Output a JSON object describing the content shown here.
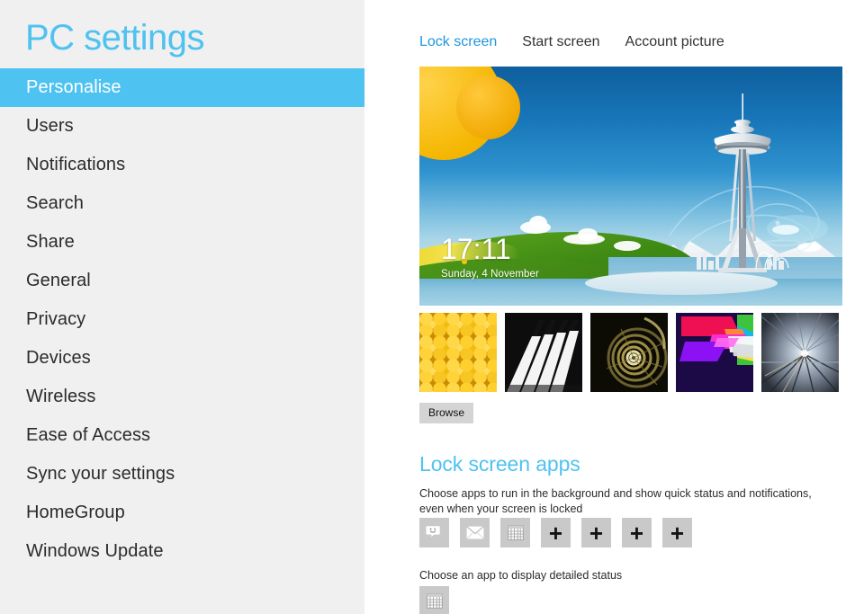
{
  "sidebar": {
    "title": "PC settings",
    "items": [
      {
        "label": "Personalise",
        "selected": true
      },
      {
        "label": "Users",
        "selected": false
      },
      {
        "label": "Notifications",
        "selected": false
      },
      {
        "label": "Search",
        "selected": false
      },
      {
        "label": "Share",
        "selected": false
      },
      {
        "label": "General",
        "selected": false
      },
      {
        "label": "Privacy",
        "selected": false
      },
      {
        "label": "Devices",
        "selected": false
      },
      {
        "label": "Wireless",
        "selected": false
      },
      {
        "label": "Ease of Access",
        "selected": false
      },
      {
        "label": "Sync your settings",
        "selected": false
      },
      {
        "label": "HomeGroup",
        "selected": false
      },
      {
        "label": "Windows Update",
        "selected": false
      }
    ]
  },
  "main": {
    "tabs": [
      {
        "label": "Lock screen",
        "active": true
      },
      {
        "label": "Start screen",
        "active": false
      },
      {
        "label": "Account picture",
        "active": false
      }
    ],
    "preview": {
      "name": "lock-screen-preview",
      "description": "Seattle Space Needle illustration with mountains, water and sun",
      "clock": "17:11",
      "date": "Sunday, 4 November"
    },
    "thumbnails": [
      {
        "name": "honeycomb",
        "selected": false
      },
      {
        "name": "piano-keys",
        "selected": false
      },
      {
        "name": "nautilus-shell",
        "selected": false
      },
      {
        "name": "colour-geometry",
        "selected": false
      },
      {
        "name": "tunnel-perspective",
        "selected": false
      }
    ],
    "browse_label": "Browse",
    "apps_section": {
      "heading": "Lock screen apps",
      "description": "Choose apps to run in the background and show quick status and notifications, even when your screen is locked",
      "tiles": [
        {
          "icon": "messaging-icon",
          "add": false
        },
        {
          "icon": "mail-icon",
          "add": false
        },
        {
          "icon": "calendar-icon",
          "add": false
        },
        {
          "icon": "add-icon",
          "add": true,
          "glyph": "+"
        },
        {
          "icon": "add-icon",
          "add": true,
          "glyph": "+"
        },
        {
          "icon": "add-icon",
          "add": true,
          "glyph": "+"
        },
        {
          "icon": "add-icon",
          "add": true,
          "glyph": "+"
        }
      ]
    },
    "detailed_status": {
      "description": "Choose an app to display detailed status",
      "tile": {
        "icon": "calendar-icon"
      }
    }
  },
  "colors": {
    "accent": "#4ec2f0",
    "tab_active": "#2196dd",
    "sidebar_bg": "#f0f0f0",
    "text": "#2b2b2b",
    "tile_bg": "#c9c9c9",
    "button_bg": "#d4d4d4"
  }
}
